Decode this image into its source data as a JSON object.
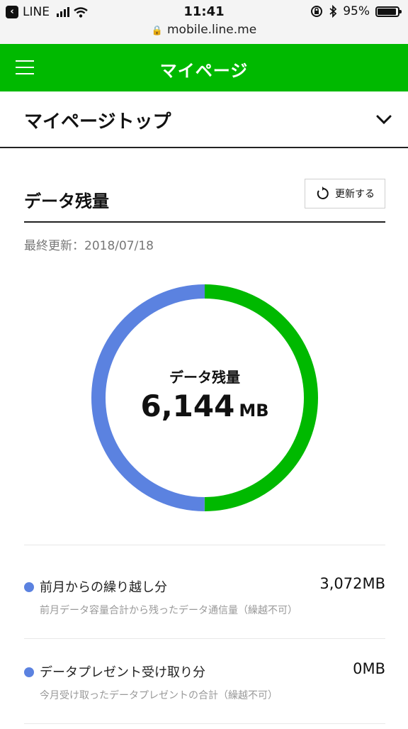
{
  "status_bar": {
    "back_app": "LINE",
    "time": "11:41",
    "battery": "95%"
  },
  "browser": {
    "url": "mobile.line.me"
  },
  "header": {
    "title": "マイページ"
  },
  "section": {
    "title": "マイページトップ"
  },
  "data_card": {
    "title": "データ残量",
    "refresh_label": "更新する",
    "last_update": "最終更新：2018/07/18",
    "donut": {
      "label": "データ残量",
      "value": "6,144",
      "unit": "MB",
      "segments": [
        {
          "color": "#00b900",
          "fraction": 0.5
        },
        {
          "color": "#5b82e0",
          "fraction": 0.5
        }
      ]
    },
    "items": [
      {
        "label": "前月からの繰り越し分",
        "value": "3,072MB",
        "note": "前月データ容量合計から残ったデータ通信量（繰越不可）",
        "color": "#5b82e0"
      },
      {
        "label": "データプレゼント受け取り分",
        "value": "0MB",
        "note": "今月受け取ったデータプレゼントの合計（繰越不可）",
        "color": "#5b82e0"
      }
    ]
  },
  "colors": {
    "brand_green": "#00b900",
    "carryover_blue": "#5b82e0"
  }
}
